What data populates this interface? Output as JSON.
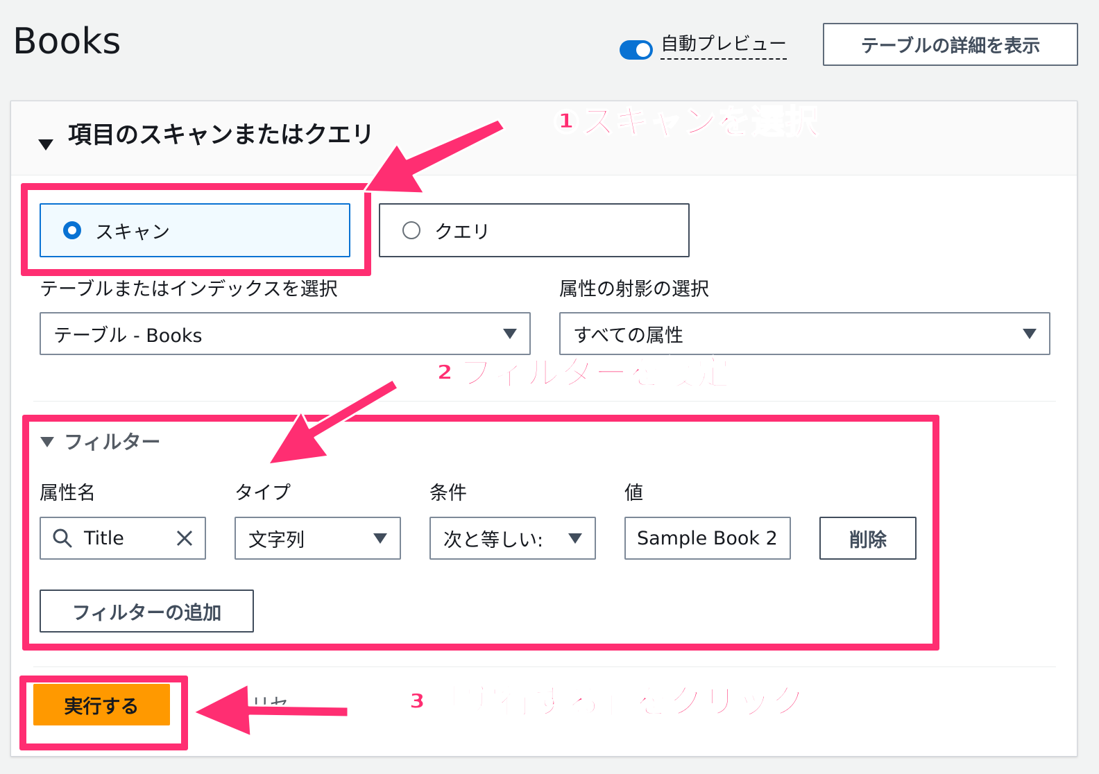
{
  "header": {
    "title": "Books",
    "auto_preview_label": "自動プレビュー",
    "auto_preview_on": true,
    "table_details_button": "テーブルの詳細を表示"
  },
  "section": {
    "title": "項目のスキャンまたはクエリ",
    "mode_options": [
      {
        "label": "スキャン",
        "selected": true
      },
      {
        "label": "クエリ",
        "selected": false
      }
    ],
    "table_index_label": "テーブルまたはインデックスを選択",
    "table_index_value": "テーブル - Books",
    "projection_label": "属性の射影の選択",
    "projection_value": "すべての属性"
  },
  "filter": {
    "title": "フィルター",
    "columns": {
      "attribute_name": "属性名",
      "type": "タイプ",
      "condition": "条件",
      "value": "値"
    },
    "row": {
      "attribute_name": "Title",
      "type": "文字列",
      "condition": "次と等しい:",
      "value": "Sample Book 2",
      "delete_button": "削除"
    },
    "add_filter_button": "フィルターの追加"
  },
  "actions": {
    "run_button": "実行する",
    "partially_hidden_text": "リセ"
  },
  "annotations": {
    "step1": "①スキャンを選択",
    "step2": "②フィルターを設定",
    "step3": "③「実行する」をクリック",
    "highlight_color": "#ff2e72"
  },
  "colors": {
    "accent": "#0972d3",
    "primary_button": "#ff9900"
  }
}
